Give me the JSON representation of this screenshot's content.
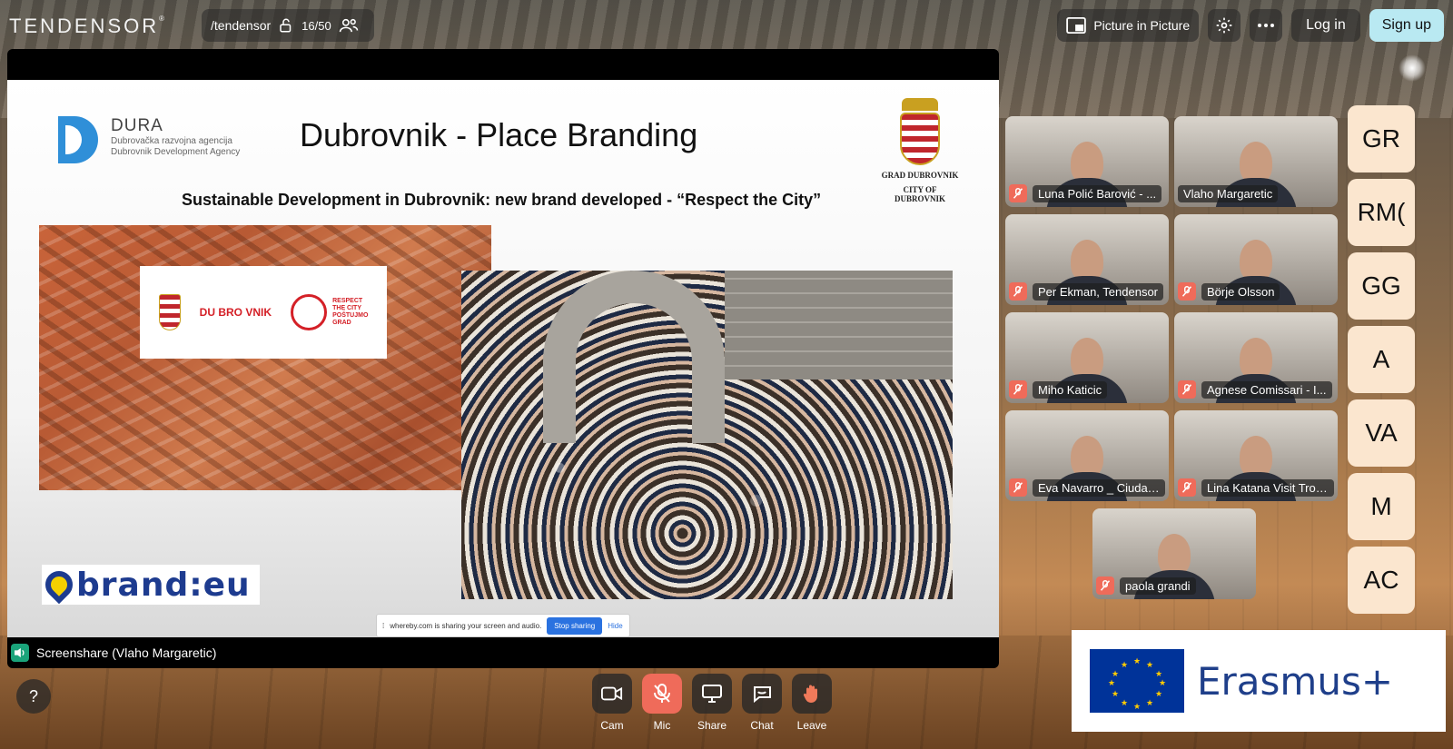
{
  "app": {
    "logo": "TENDENSOR",
    "logo_mark": "®",
    "room": "/tendensor",
    "participant_count": "16/50"
  },
  "topbar": {
    "pip_label": "Picture in Picture",
    "login_label": "Log in",
    "signup_label": "Sign up"
  },
  "screenshare": {
    "label": "Screenshare (Vlaho Margaretic)",
    "slide": {
      "dura_name": "DURA",
      "dura_line1": "Dubrovačka razvojna agencija",
      "dura_line2": "Dubrovnik Development Agency",
      "title": "Dubrovnik - Place Branding",
      "crest_line1": "GRAD DUBROVNIK",
      "crest_line2": "CITY OF DUBROVNIK",
      "subtitle": "Sustainable Development in Dubrovnik: new brand developed - “Respect the City”",
      "dubrovnik_mark": "DU BRO VNIK",
      "respect_line1": "RESPECT",
      "respect_line2": "THE CITY",
      "respect_line3": "POŠTUJMO",
      "respect_line4": "GRAD",
      "brand_eu": "brand:eu"
    },
    "share_bar": {
      "text": "whereby.com is sharing your screen and audio.",
      "stop_label": "Stop sharing",
      "hide_label": "Hide"
    }
  },
  "participants": [
    {
      "name": "Luna Polić Barović - ..."
    },
    {
      "name": "Vlaho Margaretic"
    },
    {
      "name": "Per Ekman, Tendensor"
    },
    {
      "name": "Börje Olsson"
    },
    {
      "name": "Miho Katicic"
    },
    {
      "name": "Agnese Comissari - I..."
    },
    {
      "name": "Eva Navarro _ Ciudad..."
    },
    {
      "name": "Lina Katana Visit Troll..."
    },
    {
      "name": "paola grandi"
    }
  ],
  "initials": [
    "GR",
    "RM(",
    "GG",
    "A",
    "VA",
    "M",
    "AC"
  ],
  "erasmus": {
    "text": "Erasmus+"
  },
  "controls": {
    "help": "?",
    "cam": "Cam",
    "mic": "Mic",
    "share": "Share",
    "chat": "Chat",
    "leave": "Leave"
  },
  "colors": {
    "accent_signup": "#b9e9f2",
    "muted": "#ef6b5a",
    "initials_bg": "#fbe6cf",
    "speaker": "#1aa37a"
  }
}
